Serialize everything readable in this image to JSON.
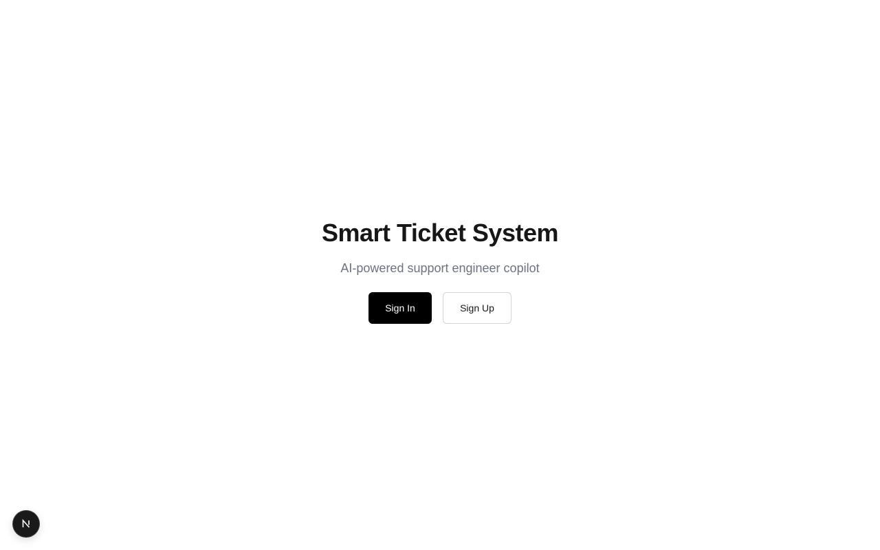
{
  "hero": {
    "title": "Smart Ticket System",
    "subtitle": "AI-powered support engineer copilot"
  },
  "actions": {
    "sign_in_label": "Sign In",
    "sign_up_label": "Sign Up"
  },
  "dev_badge": {
    "icon": "nextjs-logo-icon",
    "letter": "N"
  },
  "colors": {
    "background": "#ffffff",
    "title": "#171717",
    "subtitle": "#6b7280",
    "primary_button": "#000000",
    "secondary_border": "#d4d4d8",
    "badge": "#1a1a1a"
  }
}
